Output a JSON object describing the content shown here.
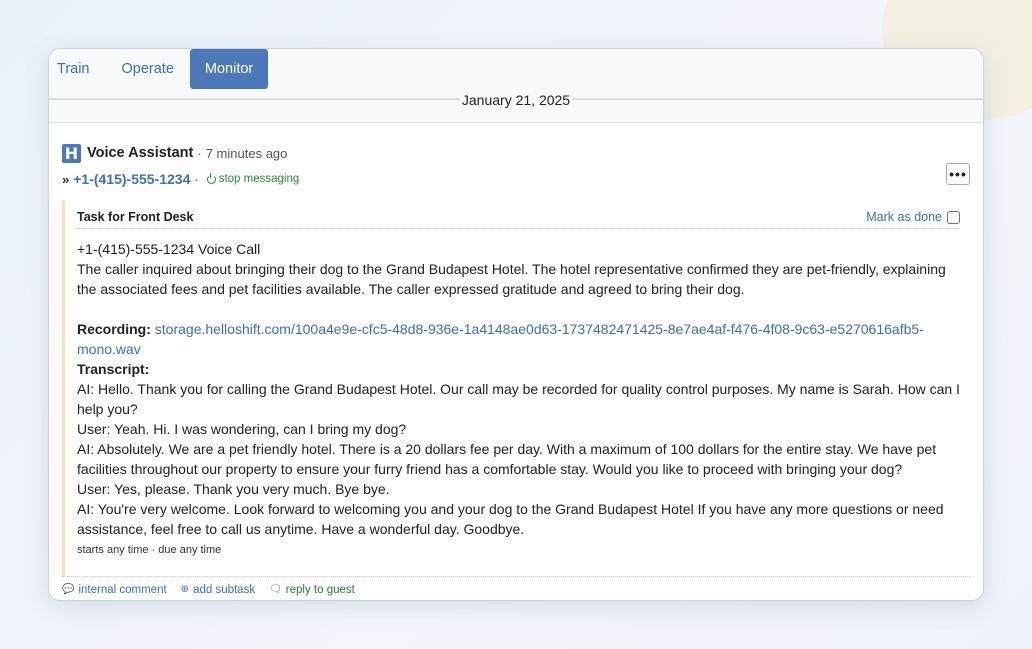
{
  "nav": {
    "tabs": [
      {
        "label": "Train"
      },
      {
        "label": "Operate"
      },
      {
        "label": "Monitor",
        "active": true
      }
    ]
  },
  "date_divider": "January 21, 2025",
  "post": {
    "logo_letter": "H",
    "author": "Voice Assistant",
    "separator": "·",
    "time_ago": "7 minutes ago",
    "more_label": "•••",
    "phone_prefix": "»",
    "phone": "+1-(415)-555-1234",
    "phone_sep": "·",
    "stop_label": "stop messaging"
  },
  "task": {
    "title": "Task for Front Desk",
    "mark_done": "Mark as done",
    "call_line": "+1-(415)-555-1234 Voice Call",
    "summary": "The caller inquired about bringing their dog to the Grand Budapest Hotel. The hotel representative confirmed they are pet-friendly, explaining the associated fees and pet facilities available. The caller expressed gratitude and agreed to bring their dog.",
    "recording_label": "Recording:",
    "recording_url": "storage.helloshift.com/100a4e9e-cfc5-48d8-936e-1a4148ae0d63-1737482471425-8e7ae4af-f476-4f08-9c63-e5270616afb5-mono.wav",
    "transcript_label": "Transcript:",
    "transcript": [
      "AI: Hello. Thank you for calling the Grand Budapest Hotel. Our call may be recorded for quality control purposes. My name is Sarah. How can I help you?",
      "User: Yeah. Hi. I was wondering, can I bring my dog?",
      "AI: Absolutely. We are a pet friendly hotel. There is a 20 dollars fee per day. With a maximum of 100 dollars for the entire stay. We have pet facilities throughout our property to ensure your furry friend has a comfortable stay. Would you like to proceed with bringing your dog?",
      "User: Yes, please. Thank you very much. Bye bye.",
      "AI: You're very welcome. Look forward to welcoming you and your dog to the Grand Budapest Hotel If you have any more questions or need assistance, feel free to call us anytime. Have a wonderful day. Goodbye."
    ],
    "footer": "starts any time · due any time"
  },
  "actions": {
    "internal_comment": "internal comment",
    "add_subtask": "add subtask",
    "reply_to_guest": "reply to guest"
  },
  "colors": {
    "primary": "#4a78b9",
    "link": "#3d6fb4",
    "green": "#2e8b3a",
    "task_border": "#f3e5b5"
  }
}
